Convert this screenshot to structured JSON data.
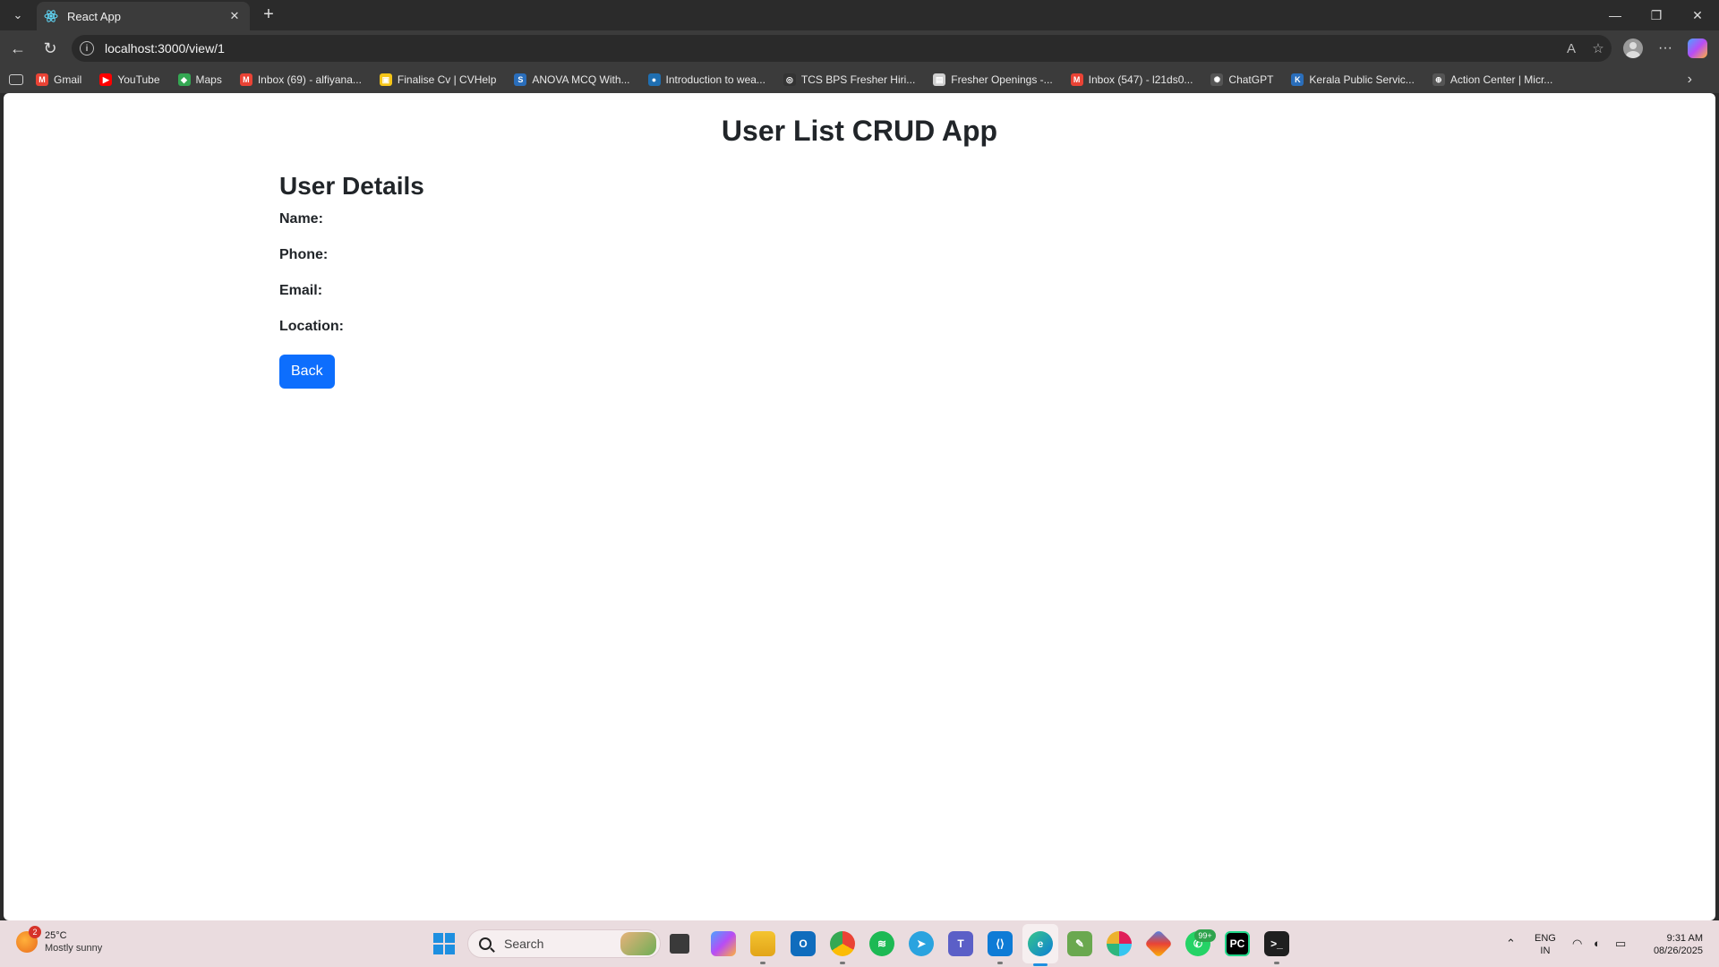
{
  "browser": {
    "tab_title": "React App",
    "url": "localhost:3000/view/1",
    "bookmarks": [
      {
        "label": "Gmail",
        "icon": "gmail-icon",
        "color": "#ea4335",
        "glyph": "M"
      },
      {
        "label": "YouTube",
        "icon": "youtube-icon",
        "color": "#ff0000",
        "glyph": "▶"
      },
      {
        "label": "Maps",
        "icon": "maps-icon",
        "color": "#34a853",
        "glyph": "◆"
      },
      {
        "label": "Inbox (69) - alfiyana...",
        "icon": "gmail-icon",
        "color": "#ea4335",
        "glyph": "M"
      },
      {
        "label": "Finalise Cv | CVHelp",
        "icon": "cvhelp-icon",
        "color": "#f5c518",
        "glyph": "▣"
      },
      {
        "label": "ANOVA MCQ With...",
        "icon": "sanfoundry-icon",
        "color": "#2a6ebb",
        "glyph": "S"
      },
      {
        "label": "Introduction to wea...",
        "icon": "globe-icon",
        "color": "#1f6fb2",
        "glyph": "●"
      },
      {
        "label": "TCS BPS Fresher Hiri...",
        "icon": "tcs-icon",
        "color": "#333333",
        "glyph": "◎"
      },
      {
        "label": "Fresher Openings -...",
        "icon": "page-icon",
        "color": "#cfcfcf",
        "glyph": "▤"
      },
      {
        "label": "Inbox (547) - l21ds0...",
        "icon": "gmail-icon",
        "color": "#ea4335",
        "glyph": "M"
      },
      {
        "label": "ChatGPT",
        "icon": "chatgpt-icon",
        "color": "#555555",
        "glyph": "✺"
      },
      {
        "label": "Kerala Public Servic...",
        "icon": "kpsc-icon",
        "color": "#2a6ebb",
        "glyph": "K"
      },
      {
        "label": "Action Center | Micr...",
        "icon": "globe-icon",
        "color": "#555555",
        "glyph": "⊕"
      }
    ]
  },
  "page": {
    "app_title": "User List CRUD App",
    "section_title": "User Details",
    "fields": {
      "name": "Name:",
      "phone": "Phone:",
      "email": "Email:",
      "location": "Location:"
    },
    "back_label": "Back",
    "accent_color": "#0d6efd"
  },
  "taskbar": {
    "weather_temp": "25°C",
    "weather_desc": "Mostly sunny",
    "weather_badge": "2",
    "search_placeholder": "Search",
    "whatsapp_badge": "99+",
    "lang_primary": "ENG",
    "lang_secondary": "IN",
    "time": "9:31 AM",
    "date": "08/26/2025"
  }
}
